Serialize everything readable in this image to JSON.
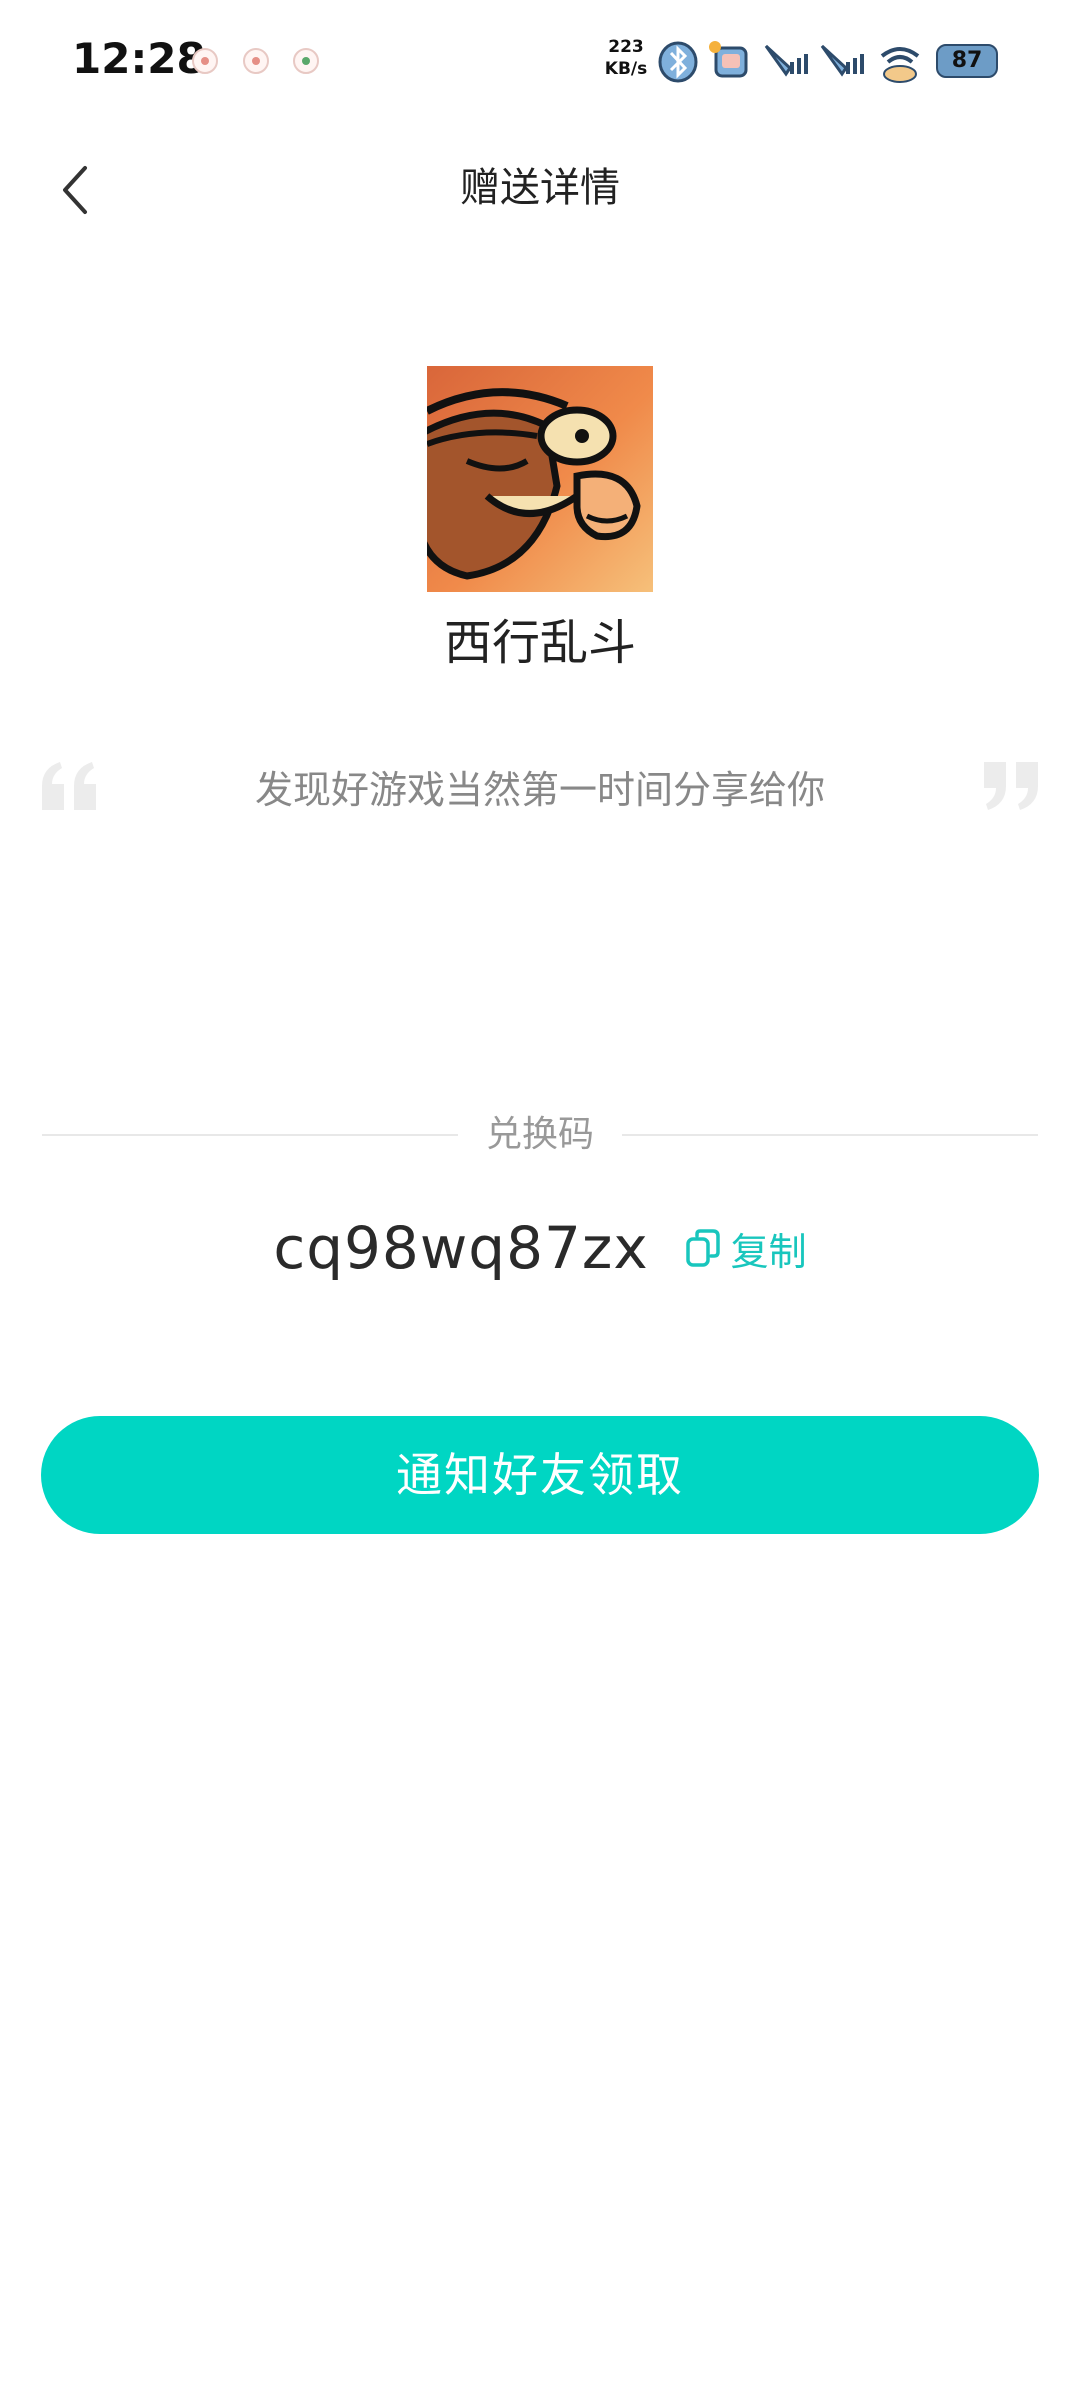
{
  "status_bar": {
    "time": "12:28",
    "net_speed_value": "223",
    "net_speed_unit": "KB/s",
    "battery": "87"
  },
  "header": {
    "back_icon": "chevron-left-icon",
    "title": "赠送详情"
  },
  "game": {
    "name": "西行乱斗"
  },
  "quote": {
    "text": "发现好游戏当然第一时间分享给你"
  },
  "redeem": {
    "label": "兑换码",
    "code": "cq98wq87zx",
    "copy_label": "复制",
    "copy_icon": "copy-icon"
  },
  "action": {
    "notify_label": "通知好友领取"
  },
  "colors": {
    "accent": "#00d6c3",
    "accent_text": "#18c6bd"
  }
}
